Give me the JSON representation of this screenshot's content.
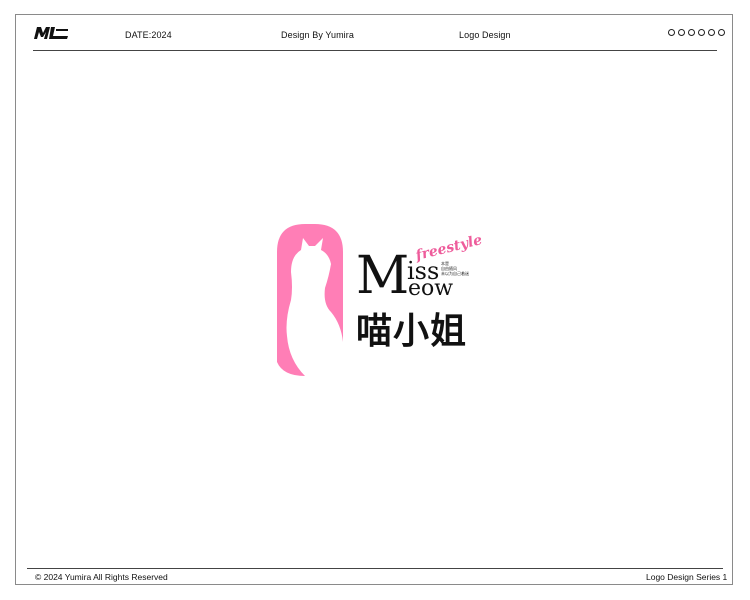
{
  "header": {
    "logo_text": "ML",
    "date": "DATE:2024",
    "designer": "Design By Yumira",
    "category": "Logo Design",
    "dot_count": 6
  },
  "logo": {
    "script_word": "freestyle",
    "word_line1": "iss",
    "word_line2": "eow",
    "initial": "M",
    "chinese_name": "喵小姐",
    "tagline_line1": "本是",
    "tagline_line2": "自由随风",
    "tagline_line3": "未以为自己着迷",
    "colors": {
      "pink": "#ff7eb6",
      "ink": "#111111"
    }
  },
  "footer": {
    "copyright": "© 2024 Yumira All Rights Reserved",
    "series": "Logo Design Series 1"
  }
}
